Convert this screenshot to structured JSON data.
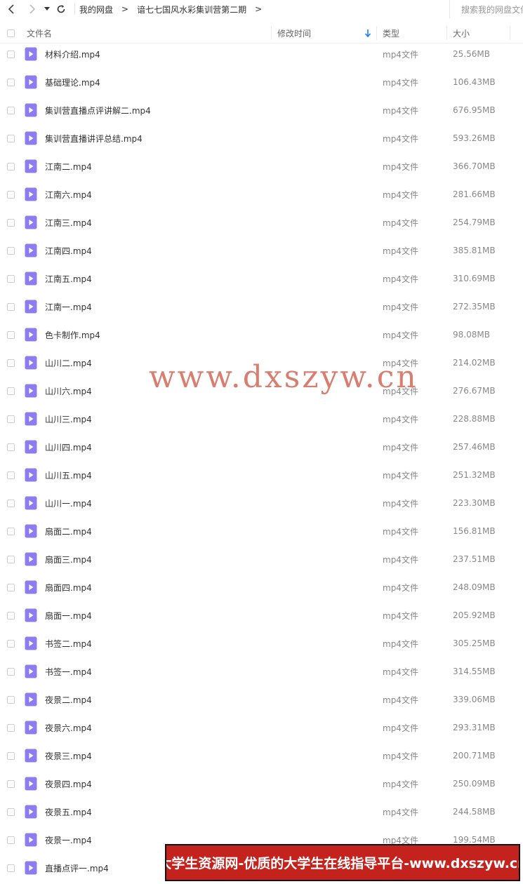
{
  "toolbar": {
    "back_icon": "chevron-left-icon",
    "forward_icon": "chevron-right-icon",
    "dropdown_icon": "caret-down-icon",
    "refresh_icon": "refresh-icon",
    "breadcrumb": [
      "我的网盘",
      "谙七七国风水彩集训营第二期"
    ],
    "breadcrumb_separator": ">",
    "search_placeholder": "搜索我的网盘文件"
  },
  "table": {
    "headers": {
      "name": "文件名",
      "modified": "修改时间",
      "type": "类型",
      "size": "大小"
    },
    "sort_icon": "arrow-down-icon",
    "accent_color": "#1a7cf5",
    "file_icon_color": "#8b7cf0",
    "rows": [
      {
        "name": "材料介绍.mp4",
        "type": "mp4文件",
        "size": "25.56MB"
      },
      {
        "name": "基础理论.mp4",
        "type": "mp4文件",
        "size": "106.43MB"
      },
      {
        "name": "集训营直播点评讲解二.mp4",
        "type": "mp4文件",
        "size": "676.95MB"
      },
      {
        "name": "集训营直播讲评总结.mp4",
        "type": "mp4文件",
        "size": "593.26MB"
      },
      {
        "name": "江南二.mp4",
        "type": "mp4文件",
        "size": "366.70MB"
      },
      {
        "name": "江南六.mp4",
        "type": "mp4文件",
        "size": "281.66MB"
      },
      {
        "name": "江南三.mp4",
        "type": "mp4文件",
        "size": "254.79MB"
      },
      {
        "name": "江南四.mp4",
        "type": "mp4文件",
        "size": "385.81MB"
      },
      {
        "name": "江南五.mp4",
        "type": "mp4文件",
        "size": "310.69MB"
      },
      {
        "name": "江南一.mp4",
        "type": "mp4文件",
        "size": "272.35MB"
      },
      {
        "name": "色卡制作.mp4",
        "type": "mp4文件",
        "size": "98.08MB"
      },
      {
        "name": "山川二.mp4",
        "type": "mp4文件",
        "size": "214.02MB"
      },
      {
        "name": "山川六.mp4",
        "type": "mp4文件",
        "size": "276.67MB"
      },
      {
        "name": "山川三.mp4",
        "type": "mp4文件",
        "size": "228.88MB"
      },
      {
        "name": "山川四.mp4",
        "type": "mp4文件",
        "size": "257.46MB"
      },
      {
        "name": "山川五.mp4",
        "type": "mp4文件",
        "size": "251.32MB"
      },
      {
        "name": "山川一.mp4",
        "type": "mp4文件",
        "size": "223.30MB"
      },
      {
        "name": "扇面二.mp4",
        "type": "mp4文件",
        "size": "156.81MB"
      },
      {
        "name": "扇面三.mp4",
        "type": "mp4文件",
        "size": "237.51MB"
      },
      {
        "name": "扇面四.mp4",
        "type": "mp4文件",
        "size": "248.09MB"
      },
      {
        "name": "扇面一.mp4",
        "type": "mp4文件",
        "size": "205.92MB"
      },
      {
        "name": "书签二.mp4",
        "type": "mp4文件",
        "size": "305.25MB"
      },
      {
        "name": "书签一.mp4",
        "type": "mp4文件",
        "size": "314.55MB"
      },
      {
        "name": "夜景二.mp4",
        "type": "mp4文件",
        "size": "339.06MB"
      },
      {
        "name": "夜景六.mp4",
        "type": "mp4文件",
        "size": "293.31MB"
      },
      {
        "name": "夜景三.mp4",
        "type": "mp4文件",
        "size": "200.71MB"
      },
      {
        "name": "夜景四.mp4",
        "type": "mp4文件",
        "size": "250.09MB"
      },
      {
        "name": "夜景五.mp4",
        "type": "mp4文件",
        "size": "244.58MB"
      },
      {
        "name": "夜景一.mp4",
        "type": "mp4文件",
        "size": "199.54MB"
      },
      {
        "name": "直播点评一.mp4",
        "type": "",
        "size": ""
      }
    ]
  },
  "watermark": "www.dxszyw.cn",
  "banner": {
    "text": "大学生资源网-优质的大学生在线指导平台-www.dxszyw.cn",
    "background_color": "#c4221c"
  }
}
